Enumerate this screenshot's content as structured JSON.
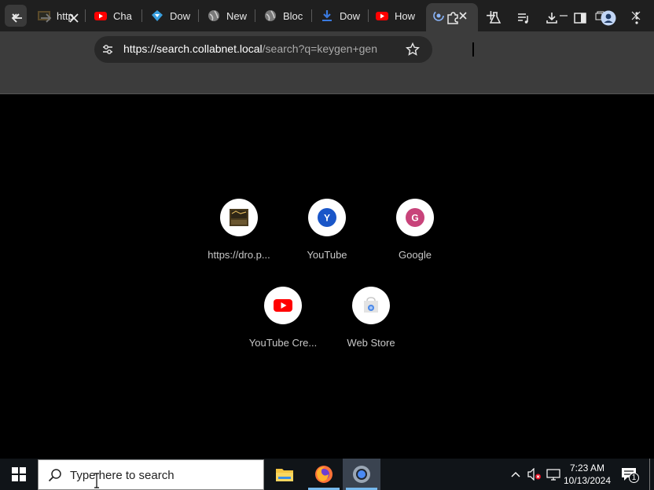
{
  "browser": {
    "tabs": [
      {
        "label": "http",
        "icon": "image-thumbnail-icon"
      },
      {
        "label": "Char",
        "icon": "youtube-icon"
      },
      {
        "label": "Dow",
        "icon": "download-diamond-icon"
      },
      {
        "label": "New",
        "icon": "globe-icon"
      },
      {
        "label": "Bloc",
        "icon": "globe-icon"
      },
      {
        "label": "Dow",
        "icon": "download-arrow-icon"
      },
      {
        "label": "How",
        "icon": "youtube-icon"
      },
      {
        "label": "",
        "icon": "loading-spinner-icon",
        "active": true
      }
    ],
    "new_tab_label": "+",
    "url_host": "https://search.collabnet.local",
    "url_rest": "/search?q=keygen+gen",
    "colors": {
      "tabstrip": "#1f1f1f",
      "toolbar": "#3c3c3c",
      "page": "#000000",
      "youtube_red": "#ff0000"
    }
  },
  "shortcuts": [
    {
      "label": "https://dro.p...",
      "icon": "site-thumbnail-icon"
    },
    {
      "label": "YouTube",
      "letter": "Y",
      "color": "#1a56c8"
    },
    {
      "label": "Google",
      "letter": "G",
      "color": "#c8437a"
    },
    {
      "label": "YouTube Cre...",
      "icon": "youtube-icon"
    },
    {
      "label": "Web Store",
      "icon": "webstore-icon"
    }
  ],
  "taskbar": {
    "search_placeholder": "Type here to search",
    "time": "7:23 AM",
    "date": "10/13/2024",
    "notification_count": "1"
  }
}
